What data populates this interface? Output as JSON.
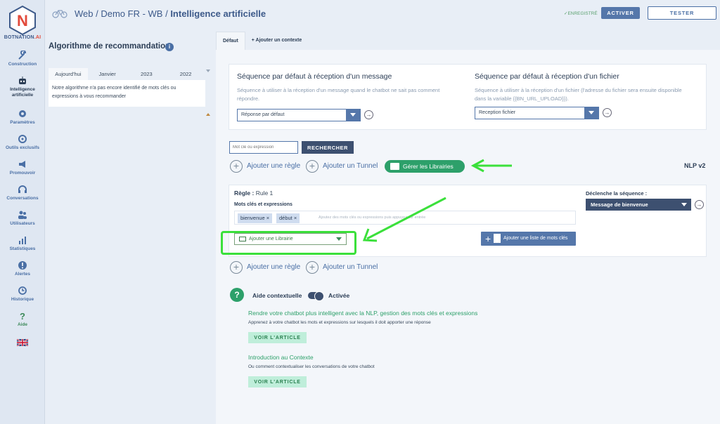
{
  "brand": {
    "name_part1": "BOTNATION",
    "name_part2": ".AI"
  },
  "sidebar": {
    "items": [
      {
        "label": "Construction",
        "icon": "wrench-icon"
      },
      {
        "label": "Intelligence artificielle",
        "icon": "robot-icon"
      },
      {
        "label": "Paramètres",
        "icon": "gear-icon"
      },
      {
        "label": "Outils exclusifs",
        "icon": "tools-icon"
      },
      {
        "label": "Promouvoir",
        "icon": "megaphone-icon"
      },
      {
        "label": "Conversations",
        "icon": "headset-icon"
      },
      {
        "label": "Utilisateurs",
        "icon": "users-icon"
      },
      {
        "label": "Statistiques",
        "icon": "chart-icon"
      },
      {
        "label": "Alertes",
        "icon": "alert-icon"
      },
      {
        "label": "Historique",
        "icon": "history-icon"
      },
      {
        "label": "Aide",
        "icon": "question-icon"
      }
    ],
    "flag_icon": "uk-flag-icon"
  },
  "header": {
    "crumb1": "Web",
    "sep1": " / ",
    "crumb2": "Demo FR - WB",
    "sep2": " / ",
    "crumb3": "Intelligence artificielle",
    "saved": "ENREGISTRÉ",
    "activate": "ACTIVER",
    "test": "TESTER"
  },
  "left_panel": {
    "title": "Algorithme de recommandation",
    "info": "i",
    "tabs": [
      "Aujourd'hui",
      "Janvier",
      "2023",
      "2022"
    ],
    "message": "Notre algorithme n'a pas encore identifié de mots clés ou expressions à vous recommander"
  },
  "main": {
    "tabs": [
      "Défaut",
      "+ Ajouter un contexte"
    ],
    "default_message": {
      "title": "Séquence par défaut à réception d'un message",
      "desc": "Séquence à utiliser à la réception d'un message quand le chatbot ne sait pas comment répondre.",
      "select": "Réponse par défaut"
    },
    "default_file": {
      "title": "Séquence par défaut à réception d'un fichier",
      "desc": "Séquence à utiliser à la réception d'un fichier (l'adresse du fichier sera ensuite disponible dans la variable {{BN_URL_UPLOAD}}).",
      "select": "Reception fichier"
    },
    "search": {
      "placeholder": "Mot clé ou expression",
      "button": "RECHERCHER"
    },
    "add_rule": "Ajouter une règle",
    "add_tunnel": "Ajouter un Tunnel",
    "manage_libraries": "Gérer les Librairies",
    "nlp_version": "NLP v2",
    "rule": {
      "label": "Règle :",
      "name": "Rule 1",
      "keywords_label": "Mots clés et expressions",
      "tags": [
        "bienvenue",
        "début"
      ],
      "tag_placeholder": "Ajoutez des mots clés ou expressions puis appuyez sur entrée",
      "add_library": "Ajouter une Librairie",
      "add_list": "Ajouter une liste de mots clés",
      "trigger_label": "Déclenche la séquence :",
      "trigger_value": "Message de bienvenue"
    },
    "help": {
      "label": "Aide contextuelle",
      "toggle": "Activée",
      "articles": [
        {
          "title": "Rendre votre chatbot plus intelligent avec la NLP, gestion des mots clés et expressions",
          "desc": "Apprenez à votre chatbot les mots et expressions sur lesquels il doit apporter une réponse",
          "button": "VOIR L'ARTICLE"
        },
        {
          "title": "Introduction au Contexte",
          "desc": "Ou comment contextualiser les conversations de votre chatbot",
          "button": "VOIR L'ARTICLE"
        }
      ]
    }
  },
  "colors": {
    "accent": "#5577aa",
    "green": "#2da06a",
    "highlight": "#3be03b",
    "dark": "#3d5070"
  }
}
